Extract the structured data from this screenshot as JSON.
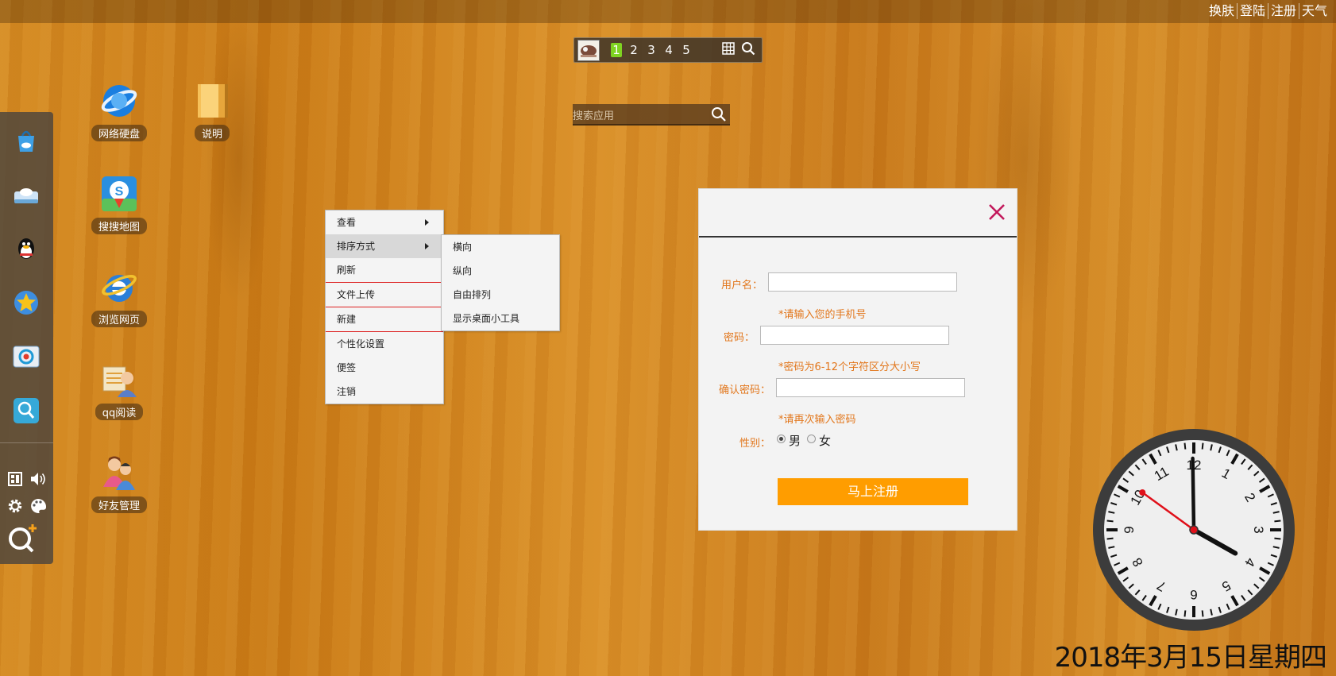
{
  "topbar": {
    "links": [
      "换肤",
      "登陆",
      "注册",
      "天气"
    ]
  },
  "pager": {
    "pages": [
      "1",
      "2",
      "3",
      "4",
      "5"
    ],
    "active_page": "1"
  },
  "app_search": {
    "placeholder": "搜索应用"
  },
  "desktop_icons": [
    {
      "label": "网络硬盘",
      "icon": "globe-disk-icon"
    },
    {
      "label": "说明",
      "icon": "folder-icon"
    },
    {
      "label": "搜搜地图",
      "icon": "map-icon"
    },
    {
      "label": "浏览网页",
      "icon": "ie-browser-icon"
    },
    {
      "label": "qq阅读",
      "icon": "qq-reader-icon"
    },
    {
      "label": "好友管理",
      "icon": "friends-icon"
    }
  ],
  "dock": {
    "apps": [
      "app-store-icon",
      "cloud-drive-icon",
      "qq-penguin-icon",
      "star-icon",
      "browser-icon",
      "search-app-icon"
    ],
    "utils": [
      "show-desktop-icon",
      "volume-icon",
      "settings-icon",
      "theme-icon",
      "qq-plus-icon"
    ]
  },
  "context_menu": {
    "items": [
      {
        "label": "查看",
        "has_submenu": true
      },
      {
        "label": "排序方式",
        "has_submenu": true,
        "highlighted": true
      },
      {
        "label": "刷新"
      },
      {
        "label": "文件上传"
      },
      {
        "label": "新建"
      },
      {
        "label": "个性化设置"
      },
      {
        "label": "便签"
      },
      {
        "label": "注销"
      }
    ],
    "submenu": [
      "横向",
      "纵向",
      "自由排列",
      "显示桌面小工具"
    ]
  },
  "register_dialog": {
    "username_label": "用户名：",
    "username_hint": "*请输入您的手机号",
    "password_label": "密码：",
    "password_hint": "*密码为6-12个字符区分大小写",
    "confirm_label": "确认密码：",
    "confirm_hint": "*请再次输入密码",
    "gender_label": "性别：",
    "gender_male": "男",
    "gender_female": "女",
    "gender_selected": "男",
    "submit_label": "马上注册",
    "accent_color": "#ff9d00",
    "label_color": "#e2761b",
    "close_color": "#c2185b"
  },
  "clock": {
    "numbers": [
      "12",
      "1",
      "2",
      "3",
      "4",
      "5",
      "6",
      "7",
      "8",
      "9",
      "10",
      "11"
    ],
    "time": "3:59:51"
  },
  "date_text": "2018年3月15日星期四"
}
